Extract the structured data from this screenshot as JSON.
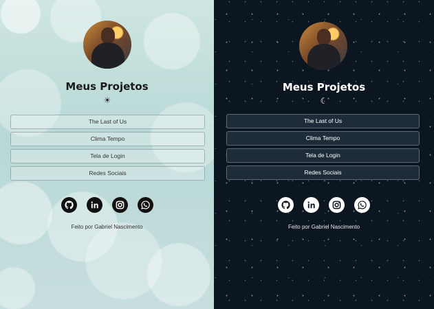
{
  "title": "Meus Projetos",
  "projects": [
    "The Last of Us",
    "Clima Tempo",
    "Tela de Login",
    "Redes Sociais"
  ],
  "footer": "Feito por Gabriel Nascimento",
  "icons": [
    "github-icon",
    "linkedin-icon",
    "instagram-icon",
    "whatsapp-icon"
  ],
  "light": {
    "mode_icon": "☀"
  },
  "dark": {
    "mode_icon": "☾"
  }
}
